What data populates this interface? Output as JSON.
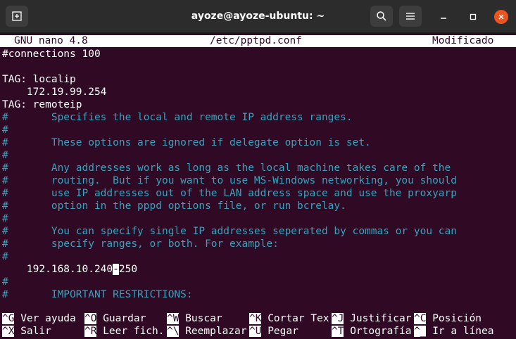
{
  "window": {
    "title": "ayoze@ayoze-ubuntu: ~",
    "close_color": "#e95420",
    "background": "#300a24",
    "comment_color": "#34a3bc"
  },
  "nano": {
    "version": "GNU nano 4.8",
    "filename": "/etc/pptpd.conf",
    "status": "Modificado"
  },
  "lines": [
    "#connections 100",
    "",
    "TAG: localip",
    "    172.19.99.254",
    "TAG: remoteip",
    "#       Specifies the local and remote IP address ranges.",
    "#",
    "#       These options are ignored if delegate option is set.",
    "#",
    "#       Any addresses work as long as the local machine takes care of the",
    "#       routing.  But if you want to use MS-Windows networking, you should",
    "#       use IP addresses out of the LAN address space and use the proxyarp",
    "#       option in the pppd options file, or run bcrelay.",
    "#",
    "#       You can specify single IP addresses seperated by commas or you can",
    "#       specify ranges, or both. For example:",
    "#",
    "    192.168.10.240",
    "",
    "#",
    "#       IMPORTANT RESTRICTIONS:"
  ],
  "cursor_line": {
    "before": "    192.168.10.240",
    "cursor_char": "-",
    "after": "250"
  },
  "shortcuts": [
    {
      "key": "^G",
      "label": " Ver ayuda"
    },
    {
      "key": "^O",
      "label": " Guardar"
    },
    {
      "key": "^W",
      "label": " Buscar"
    },
    {
      "key": "^K",
      "label": " Cortar Tex"
    },
    {
      "key": "^J",
      "label": " Justificar"
    },
    {
      "key": "^C",
      "label": " Posición"
    },
    {
      "key": "^X",
      "label": " Salir"
    },
    {
      "key": "^R",
      "label": " Leer fich."
    },
    {
      "key": "^\\",
      "label": " Reemplazar"
    },
    {
      "key": "^U",
      "label": " Pegar"
    },
    {
      "key": "^T",
      "label": " Ortografía"
    },
    {
      "key": "^_",
      "label": " Ir a línea"
    }
  ]
}
